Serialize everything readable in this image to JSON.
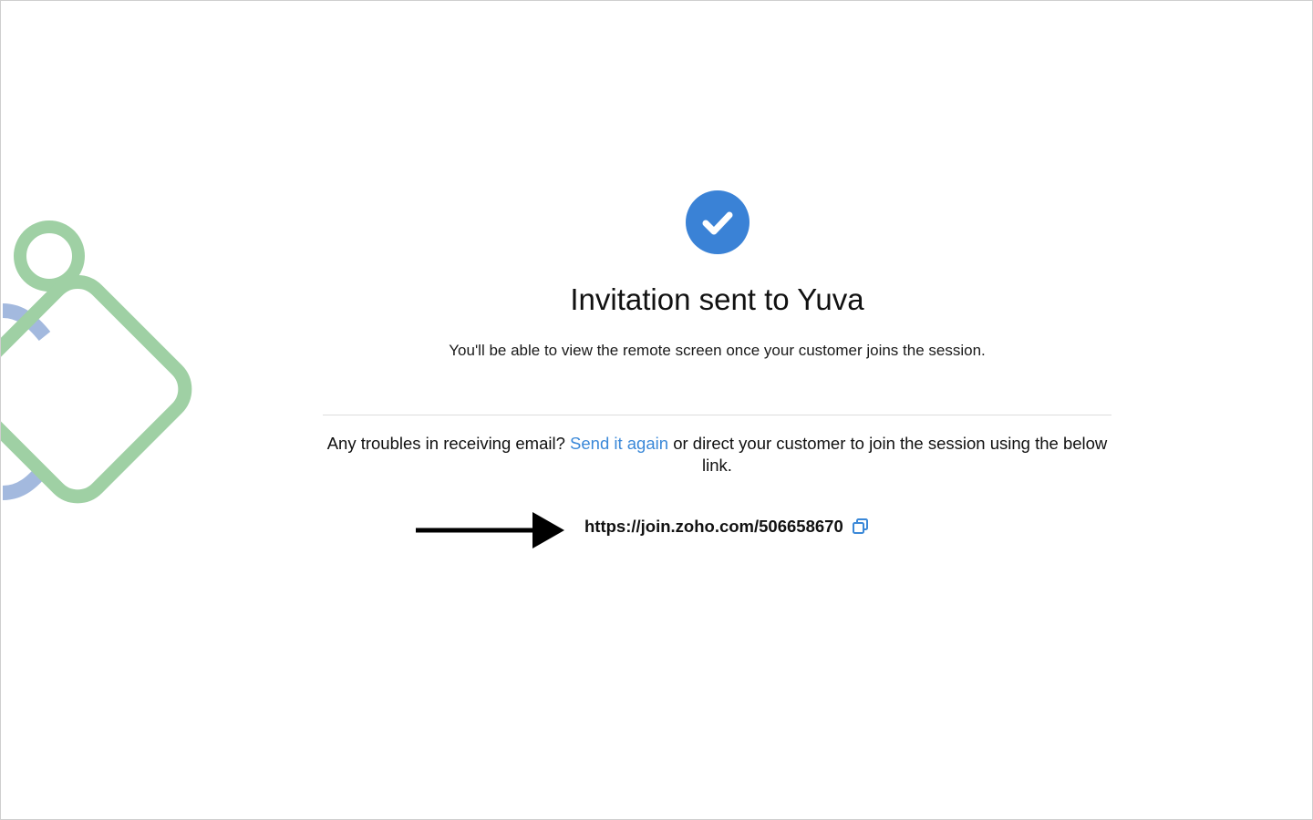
{
  "invitation": {
    "title": "Invitation sent to Yuva",
    "subtitle": "You'll be able to view the remote screen once your customer joins the session.",
    "help_prefix": "Any troubles in receiving email?",
    "resend_link": "Send it again",
    "help_suffix": "or direct your customer to join the session using the below link.",
    "session_url": "https://join.zoho.com/506658670"
  },
  "icons": {
    "success": "check-circle-icon",
    "copy": "copy-icon",
    "arrow": "arrow-right-icon",
    "decor": "decorative-shapes"
  },
  "colors": {
    "accent": "#3a82d6",
    "link": "#3a88d8",
    "decor_green": "#9fd0a4",
    "decor_blue": "#a3b9de"
  }
}
